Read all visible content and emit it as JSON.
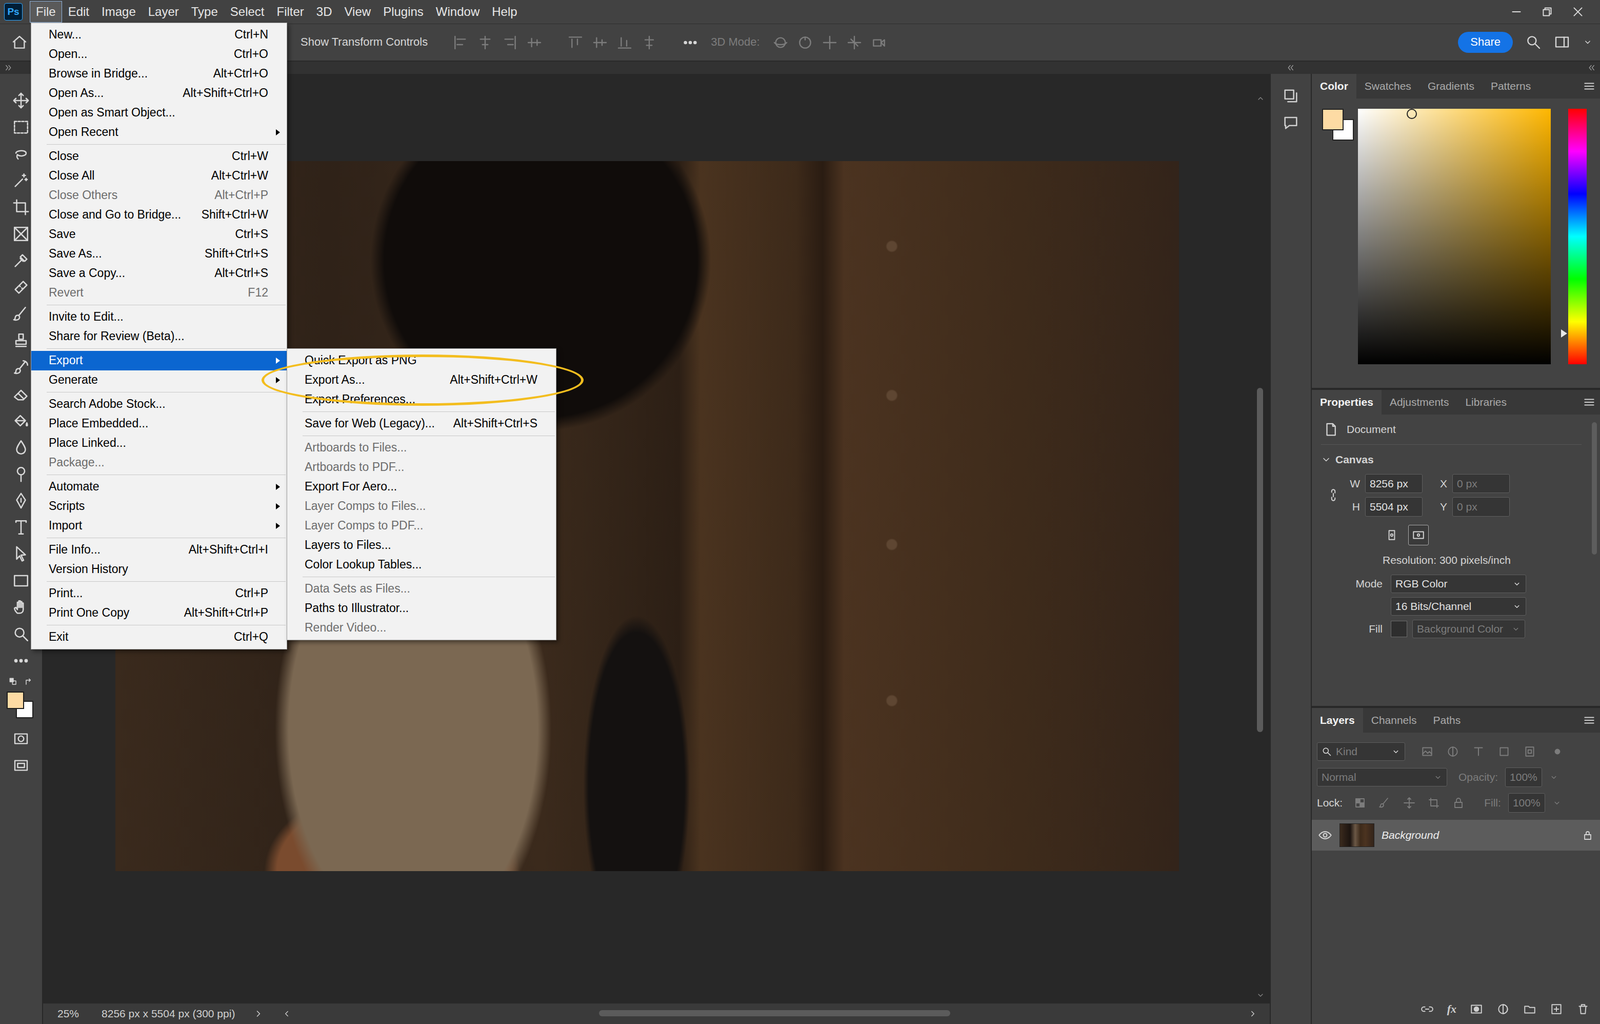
{
  "app": {
    "logo": "Ps"
  },
  "menubar": [
    {
      "label": "File",
      "selected": true
    },
    {
      "label": "Edit",
      "selected": false
    },
    {
      "label": "Image",
      "selected": false
    },
    {
      "label": "Layer",
      "selected": false
    },
    {
      "label": "Type",
      "selected": false
    },
    {
      "label": "Select",
      "selected": false
    },
    {
      "label": "Filter",
      "selected": false
    },
    {
      "label": "3D",
      "selected": false
    },
    {
      "label": "View",
      "selected": false
    },
    {
      "label": "Plugins",
      "selected": false
    },
    {
      "label": "Window",
      "selected": false
    },
    {
      "label": "Help",
      "selected": false
    }
  ],
  "options_bar": {
    "transform_label": "Show Transform Controls",
    "mode_label": "3D Mode:",
    "share": "Share"
  },
  "file_menu": {
    "groups": [
      [
        {
          "label": "New...",
          "shortcut": "Ctrl+N",
          "disabled": false,
          "submenu": false,
          "selected": false
        },
        {
          "label": "Open...",
          "shortcut": "Ctrl+O",
          "disabled": false,
          "submenu": false,
          "selected": false
        },
        {
          "label": "Browse in Bridge...",
          "shortcut": "Alt+Ctrl+O",
          "disabled": false,
          "submenu": false,
          "selected": false
        },
        {
          "label": "Open As...",
          "shortcut": "Alt+Shift+Ctrl+O",
          "disabled": false,
          "submenu": false,
          "selected": false
        },
        {
          "label": "Open as Smart Object...",
          "disabled": false,
          "submenu": false,
          "selected": false
        },
        {
          "label": "Open Recent",
          "disabled": false,
          "submenu": true,
          "selected": false
        }
      ],
      [
        {
          "label": "Close",
          "shortcut": "Ctrl+W",
          "disabled": false,
          "submenu": false,
          "selected": false
        },
        {
          "label": "Close All",
          "shortcut": "Alt+Ctrl+W",
          "disabled": false,
          "submenu": false,
          "selected": false
        },
        {
          "label": "Close Others",
          "shortcut": "Alt+Ctrl+P",
          "disabled": true,
          "submenu": false,
          "selected": false
        },
        {
          "label": "Close and Go to Bridge...",
          "shortcut": "Shift+Ctrl+W",
          "disabled": false,
          "submenu": false,
          "selected": false
        },
        {
          "label": "Save",
          "shortcut": "Ctrl+S",
          "disabled": false,
          "submenu": false,
          "selected": false
        },
        {
          "label": "Save As...",
          "shortcut": "Shift+Ctrl+S",
          "disabled": false,
          "submenu": false,
          "selected": false
        },
        {
          "label": "Save a Copy...",
          "shortcut": "Alt+Ctrl+S",
          "disabled": false,
          "submenu": false,
          "selected": false
        },
        {
          "label": "Revert",
          "shortcut": "F12",
          "disabled": true,
          "submenu": false,
          "selected": false
        }
      ],
      [
        {
          "label": "Invite to Edit...",
          "disabled": false,
          "submenu": false,
          "selected": false
        },
        {
          "label": "Share for Review (Beta)...",
          "disabled": false,
          "submenu": false,
          "selected": false
        }
      ],
      [
        {
          "label": "Export",
          "disabled": false,
          "submenu": true,
          "selected": true
        },
        {
          "label": "Generate",
          "disabled": false,
          "submenu": true,
          "selected": false
        }
      ],
      [
        {
          "label": "Search Adobe Stock...",
          "disabled": false,
          "submenu": false,
          "selected": false
        },
        {
          "label": "Place Embedded...",
          "disabled": false,
          "submenu": false,
          "selected": false
        },
        {
          "label": "Place Linked...",
          "disabled": false,
          "submenu": false,
          "selected": false
        },
        {
          "label": "Package...",
          "disabled": true,
          "submenu": false,
          "selected": false
        }
      ],
      [
        {
          "label": "Automate",
          "disabled": false,
          "submenu": true,
          "selected": false
        },
        {
          "label": "Scripts",
          "disabled": false,
          "submenu": true,
          "selected": false
        },
        {
          "label": "Import",
          "disabled": false,
          "submenu": true,
          "selected": false
        }
      ],
      [
        {
          "label": "File Info...",
          "shortcut": "Alt+Shift+Ctrl+I",
          "disabled": false,
          "submenu": false,
          "selected": false
        },
        {
          "label": "Version History",
          "disabled": false,
          "submenu": false,
          "selected": false
        }
      ],
      [
        {
          "label": "Print...",
          "shortcut": "Ctrl+P",
          "disabled": false,
          "submenu": false,
          "selected": false
        },
        {
          "label": "Print One Copy",
          "shortcut": "Alt+Shift+Ctrl+P",
          "disabled": false,
          "submenu": false,
          "selected": false
        }
      ],
      [
        {
          "label": "Exit",
          "shortcut": "Ctrl+Q",
          "disabled": false,
          "submenu": false,
          "selected": false
        }
      ]
    ]
  },
  "export_menu": {
    "groups": [
      [
        {
          "label": "Quick Export as PNG",
          "disabled": false,
          "submenu": false,
          "selected": false
        },
        {
          "label": "Export As...",
          "shortcut": "Alt+Shift+Ctrl+W",
          "disabled": false,
          "submenu": false,
          "selected": false,
          "circled": true
        },
        {
          "label": "Export Preferences...",
          "disabled": false,
          "submenu": false,
          "selected": false
        }
      ],
      [
        {
          "label": "Save for Web (Legacy)...",
          "shortcut": "Alt+Shift+Ctrl+S",
          "disabled": false,
          "submenu": false,
          "selected": false
        }
      ],
      [
        {
          "label": "Artboards to Files...",
          "disabled": true,
          "submenu": false,
          "selected": false
        },
        {
          "label": "Artboards to PDF...",
          "disabled": true,
          "submenu": false,
          "selected": false
        },
        {
          "label": "Export For Aero...",
          "disabled": false,
          "submenu": false,
          "selected": false
        },
        {
          "label": "Layer Comps to Files...",
          "disabled": true,
          "submenu": false,
          "selected": false
        },
        {
          "label": "Layer Comps to PDF...",
          "disabled": true,
          "submenu": false,
          "selected": false
        },
        {
          "label": "Layers to Files...",
          "disabled": false,
          "submenu": false,
          "selected": false
        },
        {
          "label": "Color Lookup Tables...",
          "disabled": false,
          "submenu": false,
          "selected": false
        }
      ],
      [
        {
          "label": "Data Sets as Files...",
          "disabled": true,
          "submenu": false,
          "selected": false
        },
        {
          "label": "Paths to Illustrator...",
          "disabled": false,
          "submenu": false,
          "selected": false
        },
        {
          "label": "Render Video...",
          "disabled": true,
          "submenu": false,
          "selected": false
        }
      ]
    ]
  },
  "color_panel": {
    "tabs": [
      {
        "label": "Color",
        "selected": true
      },
      {
        "label": "Swatches",
        "selected": false
      },
      {
        "label": "Gradients",
        "selected": false
      },
      {
        "label": "Patterns",
        "selected": false
      }
    ],
    "foreground": "#fddba4",
    "background": "#ffffff",
    "hue_level": 0.88,
    "saturation": 0.28,
    "brightness": 0.98
  },
  "properties_panel": {
    "tabs": [
      {
        "label": "Properties",
        "selected": true
      },
      {
        "label": "Adjustments",
        "selected": false
      },
      {
        "label": "Libraries",
        "selected": false
      }
    ],
    "document_label": "Document",
    "section": {
      "label": "Canvas",
      "expanded": true
    },
    "fields": [
      {
        "label": "W",
        "value": "8256 px",
        "disabled": false
      },
      {
        "label": "X",
        "value": "0 px",
        "disabled": true
      },
      {
        "label": "H",
        "value": "5504 px",
        "disabled": false
      },
      {
        "label": "Y",
        "value": "0 px",
        "disabled": true
      }
    ],
    "orientation": [
      {
        "kind": "portrait",
        "selected": false
      },
      {
        "kind": "landscape",
        "selected": true
      }
    ],
    "resolution": "Resolution: 300 pixels/inch",
    "mode_label": "Mode",
    "mode": "RGB Color",
    "depth": "16 Bits/Channel",
    "fill_label": "Fill",
    "fill": {
      "value": "Background Color",
      "disabled": true
    },
    "scroll": {
      "offset": 0.01,
      "level": 0.47
    }
  },
  "layers_panel": {
    "tabs": [
      {
        "label": "Layers",
        "selected": true
      },
      {
        "label": "Channels",
        "selected": false
      },
      {
        "label": "Paths",
        "selected": false
      }
    ],
    "filter": "Kind",
    "blend_mode": {
      "value": "Normal",
      "disabled": true
    },
    "opacity_label": "Opacity:",
    "opacity": {
      "value": "100%",
      "disabled": true
    },
    "lock_label": "Lock:",
    "fill_label": "Fill:",
    "fill": {
      "value": "100%",
      "disabled": true
    },
    "layers": [
      {
        "name": "Background",
        "visible": true,
        "locked": true,
        "selected": true
      }
    ],
    "fx_label": "fx"
  },
  "status_bar": {
    "zoom": "25%",
    "doc_info": "8256 px x 5504 px (300 ppi)"
  },
  "scrollbars": {
    "horizontal": {
      "offset": 0.32,
      "level": 0.37
    },
    "vertical": {
      "offset": 0.32,
      "level": 0.39
    }
  }
}
